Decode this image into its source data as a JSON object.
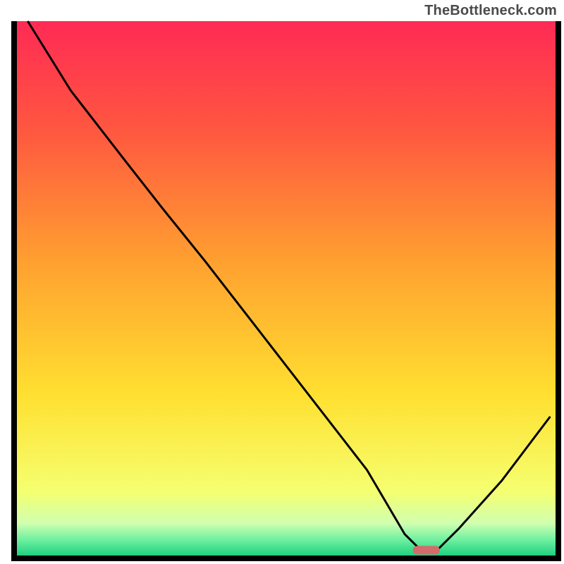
{
  "watermark": "TheBottleneck.com",
  "chart_data": {
    "type": "line",
    "title": "",
    "xlabel": "",
    "ylabel": "",
    "xlim": [
      0,
      100
    ],
    "ylim": [
      0,
      100
    ],
    "x": [
      2,
      10,
      20,
      27,
      35,
      45,
      55,
      65,
      72,
      75,
      78,
      82,
      90,
      99
    ],
    "values": [
      100,
      87,
      74,
      65,
      55,
      42,
      29,
      16,
      4,
      1,
      1,
      5,
      14,
      26
    ],
    "marker": {
      "x": 76,
      "y": 1,
      "w": 5,
      "h": 1.6,
      "color": "#d46a6a"
    },
    "gradient_stops": [
      {
        "offset": 0,
        "color": "#ff2a55"
      },
      {
        "offset": 20,
        "color": "#ff5640"
      },
      {
        "offset": 45,
        "color": "#ffa030"
      },
      {
        "offset": 70,
        "color": "#ffe030"
      },
      {
        "offset": 88,
        "color": "#f5ff70"
      },
      {
        "offset": 94,
        "color": "#d0ffb0"
      },
      {
        "offset": 97,
        "color": "#70f0a0"
      },
      {
        "offset": 100,
        "color": "#20d080"
      }
    ]
  }
}
